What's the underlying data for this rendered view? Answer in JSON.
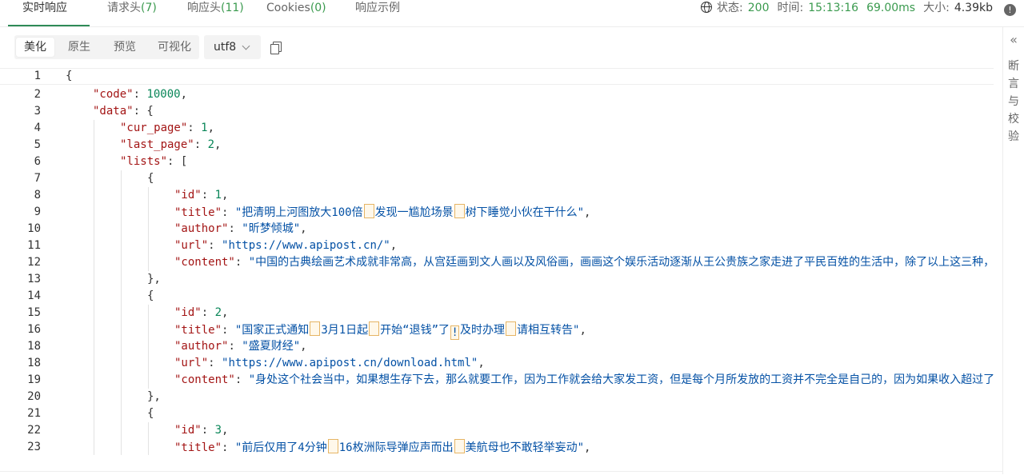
{
  "tabs": [
    {
      "label": "实时响应",
      "count": ""
    },
    {
      "label": "请求头",
      "count": "(7)"
    },
    {
      "label": "响应头",
      "count": "(11)"
    },
    {
      "label": "Cookies",
      "count": "(0)"
    },
    {
      "label": "响应示例",
      "count": ""
    }
  ],
  "status": {
    "status_label": "状态:",
    "status_value": "200",
    "time_label": "时间:",
    "time_value": "15:13:16",
    "duration_value": "69.00ms",
    "size_label": "大小:",
    "size_value": "4.39kb",
    "info_glyph": "!"
  },
  "toolbar": {
    "modes": [
      "美化",
      "原生",
      "预览",
      "可视化"
    ],
    "active_mode": "美化",
    "encoding": "utf8"
  },
  "side_panel": {
    "collapse_glyph": "«",
    "label": "断言与校验"
  },
  "code_lines": [
    {
      "n": "1",
      "indent": 0,
      "parts": [
        [
          "p",
          "{"
        ]
      ]
    },
    {
      "n": "2",
      "indent": 1,
      "parts": [
        [
          "k",
          "\"code\""
        ],
        [
          "p",
          ": "
        ],
        [
          "n",
          "10000"
        ],
        [
          "p",
          ","
        ]
      ]
    },
    {
      "n": "3",
      "indent": 1,
      "parts": [
        [
          "k",
          "\"data\""
        ],
        [
          "p",
          ": {"
        ]
      ]
    },
    {
      "n": "4",
      "indent": 2,
      "parts": [
        [
          "k",
          "\"cur_page\""
        ],
        [
          "p",
          ": "
        ],
        [
          "n",
          "1"
        ],
        [
          "p",
          ","
        ]
      ]
    },
    {
      "n": "5",
      "indent": 2,
      "parts": [
        [
          "k",
          "\"last_page\""
        ],
        [
          "p",
          ": "
        ],
        [
          "n",
          "2"
        ],
        [
          "p",
          ","
        ]
      ]
    },
    {
      "n": "6",
      "indent": 2,
      "parts": [
        [
          "k",
          "\"lists\""
        ],
        [
          "p",
          ": ["
        ]
      ]
    },
    {
      "n": "7",
      "indent": 3,
      "parts": [
        [
          "p",
          "{"
        ]
      ]
    },
    {
      "n": "8",
      "indent": 4,
      "parts": [
        [
          "k",
          "\"id\""
        ],
        [
          "p",
          ": "
        ],
        [
          "n",
          "1"
        ],
        [
          "p",
          ","
        ]
      ]
    },
    {
      "n": "9",
      "indent": 4,
      "parts": [
        [
          "k",
          "\"title\""
        ],
        [
          "p",
          ": "
        ],
        [
          "s",
          "\"把清明上河图放大100倍"
        ],
        [
          "h",
          ""
        ],
        [
          "s",
          "发现一尴尬场景"
        ],
        [
          "h",
          ""
        ],
        [
          "s",
          "树下睡觉小伙在干什么\""
        ],
        [
          "p",
          ","
        ]
      ]
    },
    {
      "n": "10",
      "indent": 4,
      "parts": [
        [
          "k",
          "\"author\""
        ],
        [
          "p",
          ": "
        ],
        [
          "s",
          "\"昕梦倾城\""
        ],
        [
          "p",
          ","
        ]
      ]
    },
    {
      "n": "11",
      "indent": 4,
      "parts": [
        [
          "k",
          "\"url\""
        ],
        [
          "p",
          ": "
        ],
        [
          "s",
          "\"https://www.apipost.cn/\""
        ],
        [
          "p",
          ","
        ]
      ]
    },
    {
      "n": "12",
      "indent": 4,
      "parts": [
        [
          "k",
          "\"content\""
        ],
        [
          "p",
          ": "
        ],
        [
          "s",
          "\"中国的古典绘画艺术成就非常高，从宫廷画到文人画以及风俗画，画画这个娱乐活动逐渐从王公贵族之家走进了平民百姓的生活中，除了以上这三种，"
        ]
      ]
    },
    {
      "n": "13",
      "indent": 3,
      "parts": [
        [
          "p",
          "},"
        ]
      ]
    },
    {
      "n": "14",
      "indent": 3,
      "parts": [
        [
          "p",
          "{"
        ]
      ]
    },
    {
      "n": "15",
      "indent": 4,
      "parts": [
        [
          "k",
          "\"id\""
        ],
        [
          "p",
          ": "
        ],
        [
          "n",
          "2"
        ],
        [
          "p",
          ","
        ]
      ]
    },
    {
      "n": "16",
      "indent": 4,
      "parts": [
        [
          "k",
          "\"title\""
        ],
        [
          "p",
          ": "
        ],
        [
          "s",
          "\"国家正式通知"
        ],
        [
          "h",
          ""
        ],
        [
          "s",
          "3月1日起"
        ],
        [
          "h",
          ""
        ],
        [
          "s",
          "开始“退钱”了"
        ],
        [
          "h",
          "!"
        ],
        [
          "s",
          "及时办理"
        ],
        [
          "h",
          ""
        ],
        [
          "s",
          "请相互转告\""
        ],
        [
          "p",
          ","
        ]
      ]
    },
    {
      "n": "18",
      "indent": 4,
      "parts": [
        [
          "k",
          "\"author\""
        ],
        [
          "p",
          ": "
        ],
        [
          "s",
          "\"盛夏财经\""
        ],
        [
          "p",
          ","
        ]
      ]
    },
    {
      "n": "18",
      "indent": 4,
      "parts": [
        [
          "k",
          "\"url\""
        ],
        [
          "p",
          ": "
        ],
        [
          "s",
          "\"https://www.apipost.cn/download.html\""
        ],
        [
          "p",
          ","
        ]
      ]
    },
    {
      "n": "19",
      "indent": 4,
      "parts": [
        [
          "k",
          "\"content\""
        ],
        [
          "p",
          ": "
        ],
        [
          "s",
          "\"身处这个社会当中，如果想生存下去，那么就要工作，因为工作就会给大家发工资，但是每个月所发放的工资并不完全是自己的，因为如果收入超过了"
        ]
      ]
    },
    {
      "n": "20",
      "indent": 3,
      "parts": [
        [
          "p",
          "},"
        ]
      ]
    },
    {
      "n": "21",
      "indent": 3,
      "parts": [
        [
          "p",
          "{"
        ]
      ]
    },
    {
      "n": "22",
      "indent": 4,
      "parts": [
        [
          "k",
          "\"id\""
        ],
        [
          "p",
          ": "
        ],
        [
          "n",
          "3"
        ],
        [
          "p",
          ","
        ]
      ]
    },
    {
      "n": "23",
      "indent": 4,
      "parts": [
        [
          "k",
          "\"title\""
        ],
        [
          "p",
          ": "
        ],
        [
          "s",
          "\"前后仅用了4分钟"
        ],
        [
          "h",
          ""
        ],
        [
          "s",
          "16枚洲际导弹应声而出"
        ],
        [
          "h",
          ""
        ],
        [
          "s",
          "美航母也不敢轻举妄动\""
        ],
        [
          "p",
          ","
        ]
      ]
    }
  ]
}
